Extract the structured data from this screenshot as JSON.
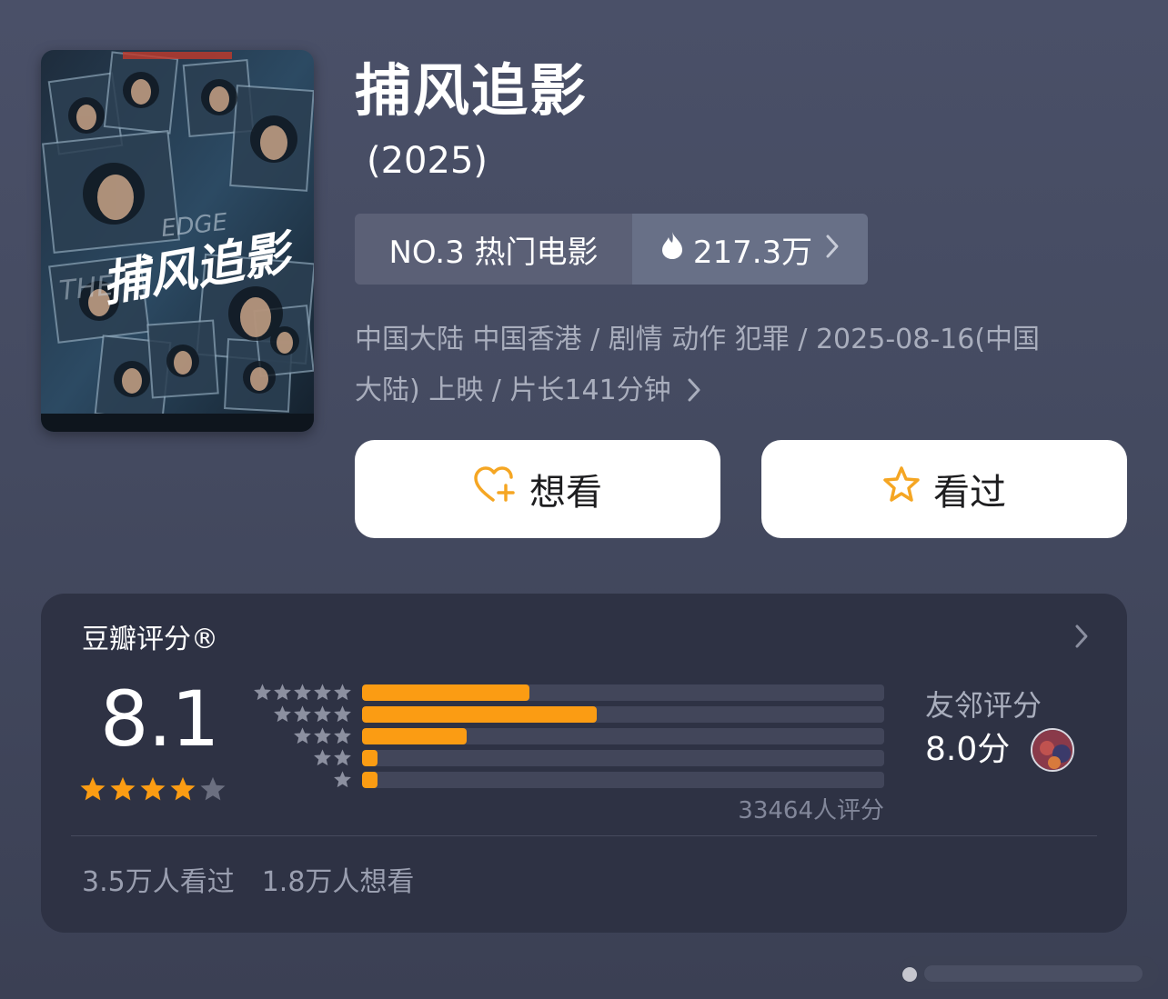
{
  "movie": {
    "title": "捕风追影",
    "year": "(2025)",
    "poster_title": "捕风追影",
    "rank_label": "NO.3 热门电影",
    "heat": "217.3万",
    "meta_line1": "中国大陆 中国香港 / 剧情 动作 犯罪 / 2025-08-16(中国",
    "meta_line2": "大陆) 上映 / 片长141分钟",
    "want_label": "想看",
    "seen_label": "看过"
  },
  "rating": {
    "title": "豆瓣评分®",
    "score": "8.1",
    "stars": 4,
    "distribution": [
      {
        "stars": 5,
        "fraction": 0.32
      },
      {
        "stars": 4,
        "fraction": 0.45
      },
      {
        "stars": 3,
        "fraction": 0.2
      },
      {
        "stars": 2,
        "fraction": 0.03
      },
      {
        "stars": 1,
        "fraction": 0.03
      }
    ],
    "count": "33464人评分",
    "friend_label": "友邻评分",
    "friend_score": "8.0分",
    "seen_count": "3.5万人看过",
    "want_count": "1.8万人想看"
  },
  "colors": {
    "accent": "#fb9c13",
    "background": "#474c63",
    "card": "#2e3244"
  },
  "icons": [
    "flame-icon",
    "chevron-right-icon",
    "heart-plus-icon",
    "star-outline-icon",
    "star-icon"
  ]
}
